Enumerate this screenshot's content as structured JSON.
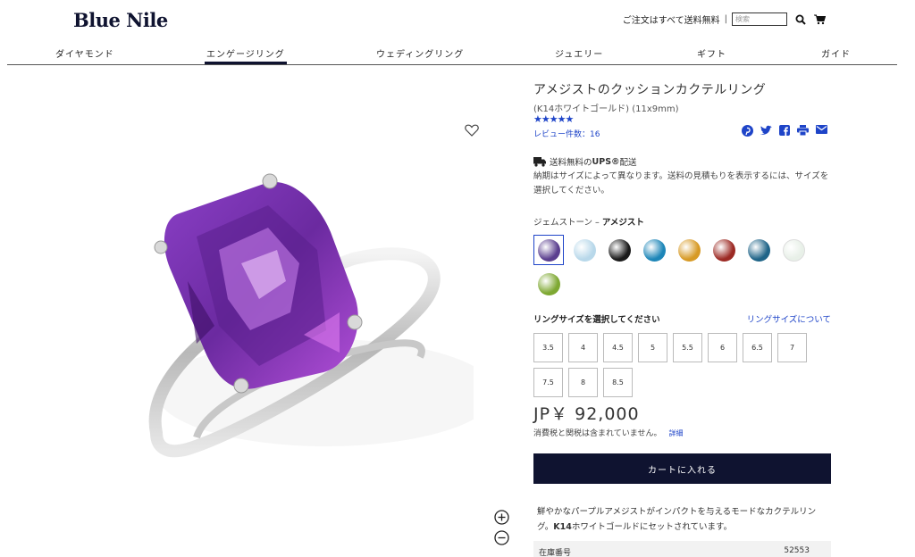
{
  "header": {
    "logo": "Blue Nile",
    "free_shipping": "ご注文はすべて送料無料",
    "separator": "|",
    "search_placeholder": "検索"
  },
  "nav": {
    "items": [
      "ダイヤモンド",
      "エンゲージリング",
      "ウェディングリング",
      "ジュエリー",
      "ギフト",
      "ガイド"
    ],
    "active": "エンゲージリング"
  },
  "product": {
    "title": "アメジストのクッションカクテルリング",
    "subtitle": "(K14ホワイトゴールド) (11x9mm)",
    "rating_stars": "★★★★★",
    "rating": 5,
    "reviews": "レビュー件数：16",
    "shipping_title_prefix": "送料無料の",
    "shipping_title_bold": "UPS®",
    "shipping_title_suffix": "配送",
    "shipping_note": "納期はサイズによって異なります。送料の見積もりを表示するには、サイズを選択してください。",
    "gem_label": "ジェムストーン –",
    "gem_selected": "アメジスト",
    "gems": [
      {
        "name": "amethyst",
        "color": "#5b3f8f"
      },
      {
        "name": "aquamarine",
        "color": "#b8d8ea"
      },
      {
        "name": "black-onyx",
        "color": "#1a1a1a"
      },
      {
        "name": "swiss-blue-topaz",
        "color": "#1d86b8"
      },
      {
        "name": "citrine",
        "color": "#d79a25"
      },
      {
        "name": "garnet",
        "color": "#9c2a24"
      },
      {
        "name": "london-blue-topaz",
        "color": "#1f6488"
      },
      {
        "name": "opal",
        "color": "#e8f0e8"
      },
      {
        "name": "peridot",
        "color": "#7ea832"
      }
    ],
    "size_label": "リングサイズを選択してください",
    "size_guide": "リングサイズについて",
    "sizes": [
      "3.5",
      "4",
      "4.5",
      "5",
      "5.5",
      "6",
      "6.5",
      "7",
      "7.5",
      "8",
      "8.5"
    ],
    "price": "JP￥ 92,000",
    "tax_note": "消費税と関税は含まれていません。",
    "tax_detail": "詳細",
    "cart_button": "カートに入れる",
    "description_prefix": "鮮やかなパープルアメジストがインパクトを与えるモードなカクテルリング。",
    "description_bold": "K14",
    "description_suffix": "ホワイトゴールドにセットされています。",
    "sku_label": "在庫番号",
    "sku_value": "52553"
  },
  "colors": {
    "brand": "#0f1330",
    "link": "#1e44c8"
  }
}
